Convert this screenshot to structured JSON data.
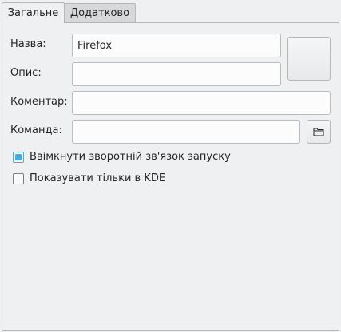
{
  "tabs": [
    {
      "label": "Загальне",
      "active": true
    },
    {
      "label": "Додатково",
      "active": false
    }
  ],
  "form": {
    "name_label": "Назва:",
    "name_value": "Firefox",
    "description_label": "Опис:",
    "description_value": "",
    "comment_label": "Коментар:",
    "comment_value": "",
    "command_label": "Команда:",
    "command_value": ""
  },
  "icons": {
    "app_icon": "app-icon-placeholder",
    "browse": "folder-icon"
  },
  "options": [
    {
      "label": "Ввімкнути зворотній зв'язок запуску",
      "checked": true
    },
    {
      "label": "Показувати тільки в KDE",
      "checked": false
    }
  ],
  "colors": {
    "accent": "#3daee9",
    "background": "#eff0f1",
    "inactive_tab": "#d6d8da"
  }
}
